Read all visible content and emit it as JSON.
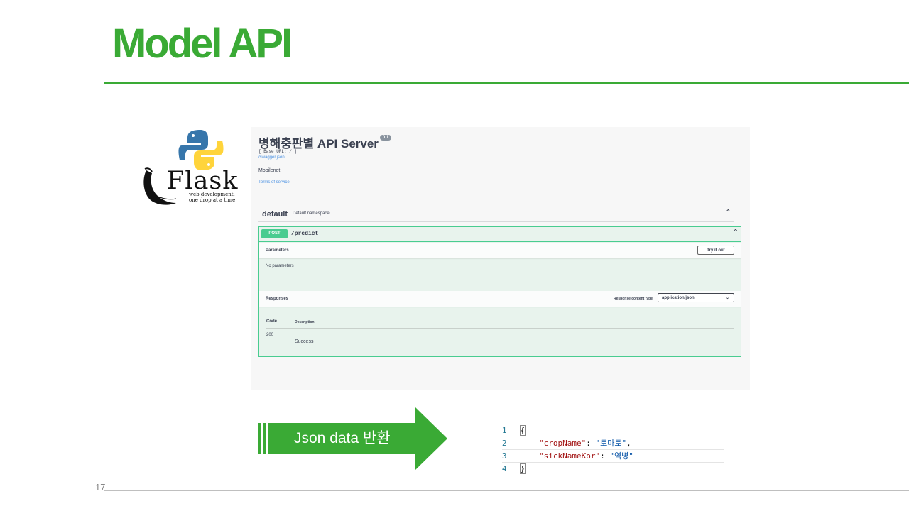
{
  "slide": {
    "title": "Model API",
    "page_number": "17",
    "accent_color": "#3aaa35"
  },
  "flask_logo": {
    "wordmark": "Flask",
    "tagline_line1": "web development,",
    "tagline_line2": "one drop at a time",
    "icon": "python-logo-icon"
  },
  "swagger": {
    "title": "병해충판별 API Server",
    "version": "0.1",
    "base_url": "[ Base URL: / ]",
    "spec_link": "/swagger.json",
    "description": "Mobilenet",
    "terms_link": "Terms of service",
    "namespace": {
      "name": "default",
      "description": "Default namespace"
    },
    "operation": {
      "method": "POST",
      "path": "/predict",
      "parameters_label": "Parameters",
      "try_button": "Try it out",
      "no_parameters": "No parameters",
      "responses_label": "Responses",
      "content_type_label": "Response content type",
      "content_type_value": "application/json",
      "table_headers": [
        "Code",
        "Description"
      ],
      "responses": [
        {
          "code": "200",
          "description": "Success"
        }
      ],
      "method_color": "#49cc90"
    }
  },
  "arrow": {
    "label": "Json data 반환",
    "color": "#3aaa35"
  },
  "json_output": {
    "lines": [
      {
        "num": "1",
        "text": "{"
      },
      {
        "num": "2",
        "key": "\"cropName\"",
        "value": "\"토마토\"",
        "trail": ","
      },
      {
        "num": "3",
        "key": "\"sickNameKor\"",
        "value": "\"역병\"",
        "trail": ""
      },
      {
        "num": "4",
        "text": "}"
      }
    ]
  }
}
